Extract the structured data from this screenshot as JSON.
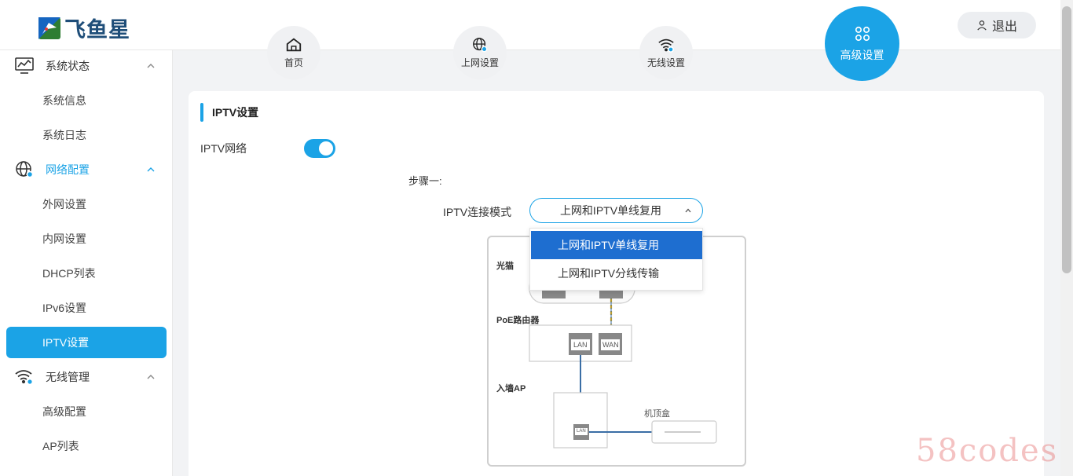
{
  "app": {
    "logo_text": "飞鱼星"
  },
  "top_nav": [
    {
      "label": "首页",
      "icon": "home-icon"
    },
    {
      "label": "上网设置",
      "icon": "globe-gear-icon"
    },
    {
      "label": "无线设置",
      "icon": "wifi-gear-icon"
    },
    {
      "label": "高级设置",
      "icon": "grid-icon",
      "active": true
    }
  ],
  "logout_label": "退出",
  "sidebar": {
    "groups": [
      {
        "label": "系统状态",
        "icon": "monitor-icon",
        "items": [
          "系统信息",
          "系统日志"
        ]
      },
      {
        "label": "网络配置",
        "icon": "globe-gear-icon",
        "items": [
          "外网设置",
          "内网设置",
          "DHCP列表",
          "IPv6设置",
          "IPTV设置"
        ]
      },
      {
        "label": "无线管理",
        "icon": "wifi-gear-icon",
        "items": [
          "高级配置",
          "AP列表"
        ]
      }
    ],
    "active_item": "IPTV设置"
  },
  "content": {
    "section_title": "IPTV设置",
    "iptv_network_label": "IPTV网络",
    "iptv_enabled": true,
    "step_label": "步骤一:",
    "mode_label": "IPTV连接模式",
    "mode_value": "上网和IPTV单线复用",
    "mode_options": [
      "上网和IPTV单线复用",
      "上网和IPTV分线传输"
    ],
    "diagram": {
      "modem_label": "光猫",
      "router_label": "PoE路由器",
      "lan_port": "LAN",
      "wan_port": "WAN",
      "ap_label": "入墙AP",
      "ap_port": "LAN",
      "stb_label": "机顶盒"
    }
  },
  "watermark": "58codes",
  "colors": {
    "accent": "#1ba3e6",
    "selected_option": "#1e6ed0"
  }
}
